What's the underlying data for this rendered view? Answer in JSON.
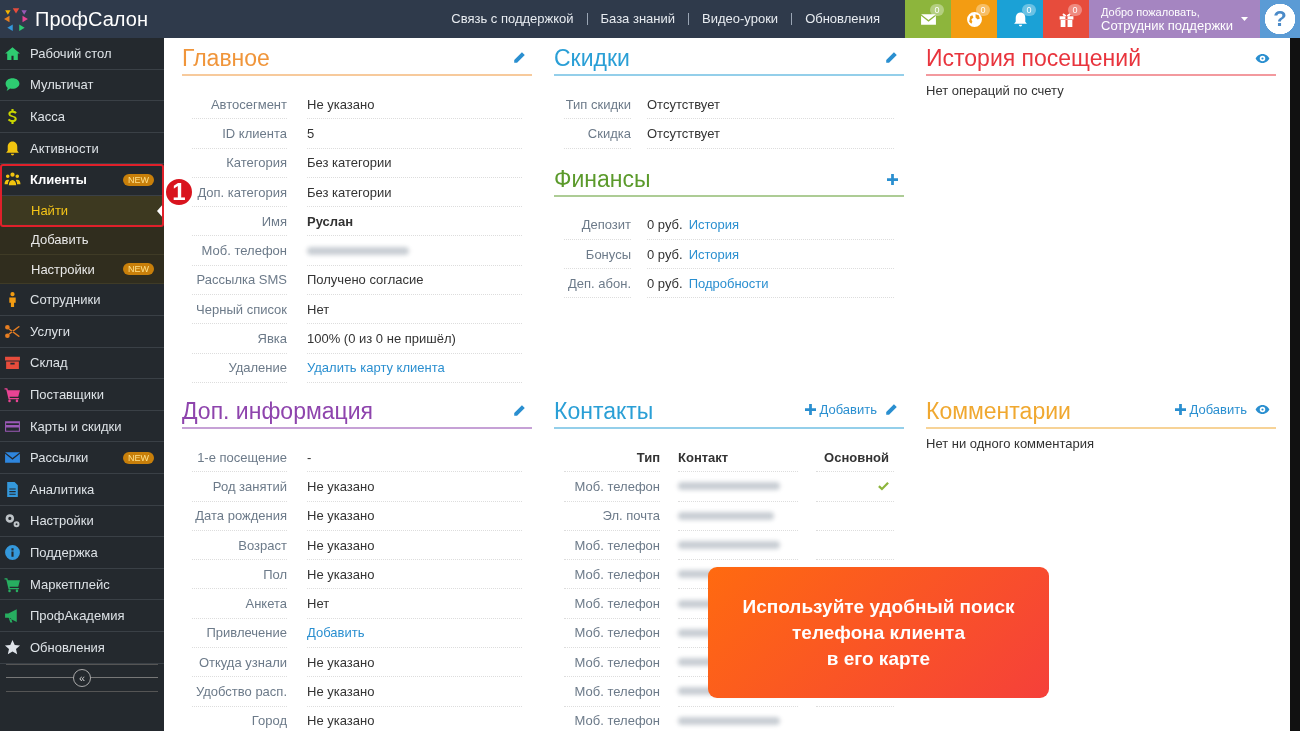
{
  "header": {
    "logo_text": "ПрофСалон",
    "nav": [
      "Связь с поддержкой",
      "База знаний",
      "Видео-уроки",
      "Обновления"
    ],
    "badges": [
      {
        "count": "0",
        "color": "#8db53c"
      },
      {
        "count": "0",
        "color": "#f39c12"
      },
      {
        "count": "0",
        "color": "#1ba1d6"
      },
      {
        "count": "0",
        "color": "#e74c3c"
      }
    ],
    "user": {
      "greeting": "Добро пожаловать,",
      "name": "Сотрудник поддержки"
    },
    "help": "?"
  },
  "sidebar": {
    "items": [
      {
        "label": "Рабочий стол",
        "selected": false,
        "expanded": false
      },
      {
        "label": "Мультичат",
        "selected": false,
        "expanded": false
      },
      {
        "label": "Касса",
        "selected": false,
        "expanded": false
      },
      {
        "label": "Активности",
        "selected": false,
        "expanded": false
      },
      {
        "label": "Клиенты",
        "badge": "NEW",
        "selected": false,
        "expanded": true,
        "children": [
          {
            "label": "Найти",
            "selected": true
          },
          {
            "label": "Добавить",
            "selected": false
          },
          {
            "label": "Настройки",
            "badge": "NEW",
            "selected": false
          }
        ]
      },
      {
        "label": "Сотрудники",
        "selected": false,
        "expanded": false
      },
      {
        "label": "Услуги",
        "selected": false,
        "expanded": false
      },
      {
        "label": "Склад",
        "selected": false,
        "expanded": false
      },
      {
        "label": "Поставщики",
        "selected": false,
        "expanded": false
      },
      {
        "label": "Карты и скидки",
        "selected": false,
        "expanded": false
      },
      {
        "label": "Рассылки",
        "badge": "NEW",
        "selected": false,
        "expanded": false
      },
      {
        "label": "Аналитика",
        "selected": false,
        "expanded": false
      },
      {
        "label": "Настройки",
        "selected": false,
        "expanded": false
      },
      {
        "label": "Поддержка",
        "selected": false,
        "expanded": false
      },
      {
        "label": "Маркетплейс",
        "selected": false,
        "expanded": false
      },
      {
        "label": "ПрофАкадемия",
        "selected": false,
        "expanded": false
      },
      {
        "label": "Обновления",
        "selected": false,
        "expanded": false
      }
    ],
    "collapse": "«"
  },
  "step_marker": "1",
  "panel_rows": [
    {
      "cells": [
        {
          "sections": [
            {
              "title": "Главное",
              "color": "#f0953a",
              "actions": [
                {
                  "kind": "edit"
                }
              ],
              "rows": [
                {
                  "label": "Автосегмент",
                  "value": "Не указано",
                  "kind": "text"
                },
                {
                  "label": "ID клиента",
                  "value": "5",
                  "kind": "text"
                },
                {
                  "label": "Категория",
                  "value": "Без категории",
                  "kind": "text"
                },
                {
                  "label": "Доп. категория",
                  "value": "Без категории",
                  "kind": "text"
                },
                {
                  "label": "Имя",
                  "value": "Руслан",
                  "kind": "bold"
                },
                {
                  "label": "Моб. телефон",
                  "kind": "blurred"
                },
                {
                  "label": "Рассылка SMS",
                  "value": "Получено согласие",
                  "kind": "text"
                },
                {
                  "label": "Черный список",
                  "value": "Нет",
                  "kind": "text"
                },
                {
                  "label": "Явка",
                  "value": "100% (0 из 0 не пришёл)",
                  "kind": "text"
                },
                {
                  "label": "Удаление",
                  "value": "Удалить карту клиента",
                  "kind": "link"
                }
              ]
            }
          ]
        },
        {
          "sections": [
            {
              "title": "Скидки",
              "color": "#2a9fd6",
              "actions": [
                {
                  "kind": "edit"
                }
              ],
              "rows": [
                {
                  "label": "Тип скидки",
                  "value": "Отсутствует",
                  "kind": "text"
                },
                {
                  "label": "Скидка",
                  "value": "Отсутствует",
                  "kind": "text"
                }
              ]
            },
            {
              "title": "Финансы",
              "color": "#5b9a2b",
              "actions": [
                {
                  "kind": "add"
                }
              ],
              "rows": [
                {
                  "label": "Депозит",
                  "value": "0 руб.",
                  "link": "История",
                  "kind": "money"
                },
                {
                  "label": "Бонусы",
                  "value": "0 руб.",
                  "link": "История",
                  "kind": "money"
                },
                {
                  "label": "Деп. абон.",
                  "value": "0 руб.",
                  "link": "Подробности",
                  "kind": "money"
                }
              ]
            }
          ]
        },
        {
          "sections": [
            {
              "title": "История посещений",
              "color": "#e8343d",
              "actions": [
                {
                  "kind": "view"
                }
              ],
              "empty_text": "Нет операций по счету"
            }
          ]
        }
      ]
    },
    {
      "cells": [
        {
          "sections": [
            {
              "title": "Доп. информация",
              "color": "#8e44ad",
              "actions": [
                {
                  "kind": "edit"
                }
              ],
              "rows": [
                {
                  "label": "1-е посещение",
                  "value": "-",
                  "kind": "text"
                },
                {
                  "label": "Род занятий",
                  "value": "Не указано",
                  "kind": "text"
                },
                {
                  "label": "Дата рождения",
                  "value": "Не указано",
                  "kind": "text"
                },
                {
                  "label": "Возраст",
                  "value": "Не указано",
                  "kind": "text"
                },
                {
                  "label": "Пол",
                  "value": "Не указано",
                  "kind": "text"
                },
                {
                  "label": "Анкета",
                  "value": "Нет",
                  "kind": "text"
                },
                {
                  "label": "Привлечение",
                  "value": "Добавить",
                  "kind": "link"
                },
                {
                  "label": "Откуда узнали",
                  "value": "Не указано",
                  "kind": "text"
                },
                {
                  "label": "Удобство расп.",
                  "value": "Не указано",
                  "kind": "text"
                },
                {
                  "label": "Город",
                  "value": "Не указано",
                  "kind": "text"
                }
              ]
            }
          ]
        },
        {
          "sections": [
            {
              "title": "Контакты",
              "color": "#2a9fd6",
              "actions": [
                {
                  "kind": "add",
                  "label": "Добавить"
                },
                {
                  "kind": "edit"
                }
              ],
              "table": {
                "columns": [
                  "Тип",
                  "Контакт",
                  "Основной"
                ],
                "rows": [
                  {
                    "type": "Моб. телефон",
                    "primary": true
                  },
                  {
                    "type": "Эл. почта",
                    "primary": false
                  },
                  {
                    "type": "Моб. телефон",
                    "primary": false
                  },
                  {
                    "type": "Моб. телефон"
                  },
                  {
                    "type": "Моб. телефон"
                  },
                  {
                    "type": "Моб. телефон"
                  },
                  {
                    "type": "Моб. телефон"
                  },
                  {
                    "type": "Моб. телефон"
                  },
                  {
                    "type": "Моб. телефон",
                    "primary": false
                  }
                ]
              }
            }
          ]
        },
        {
          "sections": [
            {
              "title": "Комментарии",
              "color": "#f0a830",
              "actions": [
                {
                  "kind": "add",
                  "label": "Добавить"
                },
                {
                  "kind": "view"
                }
              ],
              "empty_text": "Нет ни одного комментария"
            }
          ]
        }
      ]
    }
  ],
  "promo": {
    "lines": [
      "Используйте удобный поиск",
      "телефона клиента",
      "в его карте"
    ]
  }
}
